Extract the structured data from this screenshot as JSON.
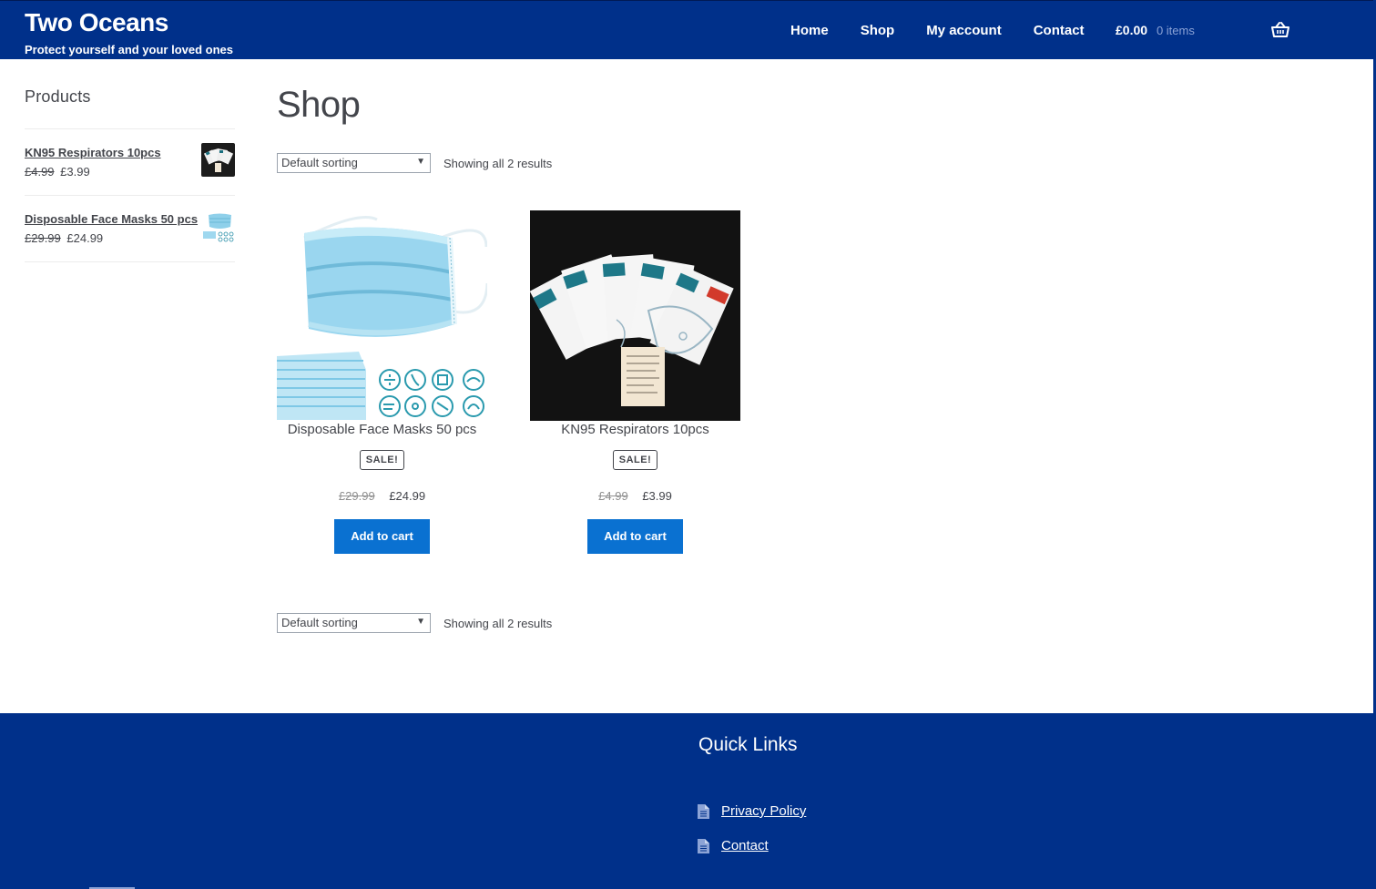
{
  "header": {
    "site_title": "Two Oceans",
    "site_description": "Protect yourself and your loved ones",
    "nav": [
      "Home",
      "Shop",
      "My account",
      "Contact"
    ],
    "cart_total": "£0.00",
    "cart_items": "0 items",
    "colors": {
      "header_bg": "#00308a",
      "button": "#0a71d1"
    }
  },
  "sidebar": {
    "title": "Products",
    "items": [
      {
        "name": "KN95 Respirators 10pcs",
        "old_price": "£4.99",
        "price": "£3.99"
      },
      {
        "name": "Disposable Face Masks 50 pcs",
        "old_price": "£29.99",
        "price": "£24.99"
      }
    ]
  },
  "main": {
    "page_title": "Shop",
    "sort_label": "Default sorting",
    "result_count": "Showing all 2 results",
    "products": [
      {
        "name": "Disposable Face Masks 50 pcs",
        "badge": "SALE!",
        "old_price": "£29.99",
        "price": "£24.99",
        "button": "Add to cart"
      },
      {
        "name": "KN95 Respirators 10pcs",
        "badge": "SALE!",
        "old_price": "£4.99",
        "price": "£3.99",
        "button": "Add to cart"
      }
    ]
  },
  "footer": {
    "title": "Quick Links",
    "links": [
      "Privacy Policy",
      "Contact"
    ]
  }
}
